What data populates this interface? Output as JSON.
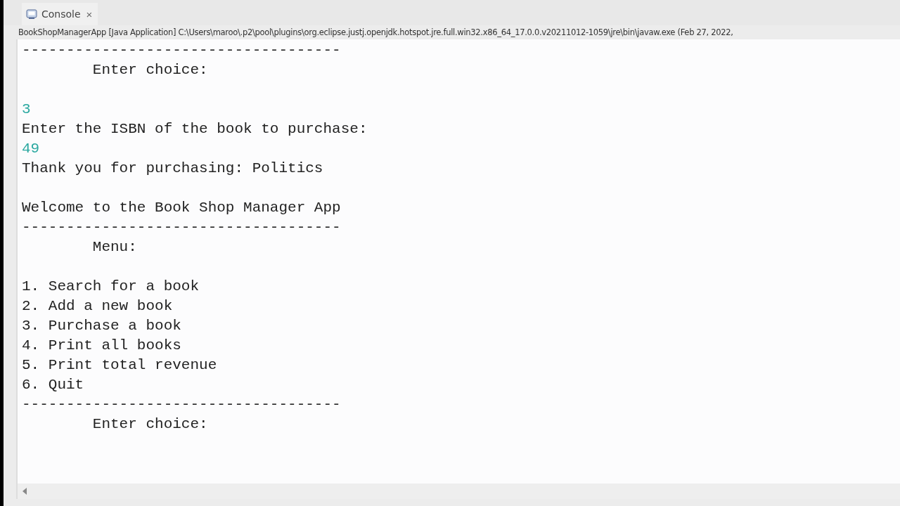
{
  "tab": {
    "label": "Console",
    "selected": true,
    "close_glyph": "×"
  },
  "launch_info": "BookShopManagerApp [Java Application] C:\\Users\\maroo\\.p2\\pool\\plugins\\org.eclipse.justj.openjdk.hotspot.jre.full.win32.x86_64_17.0.0.v20211012-1059\\jre\\bin\\javaw.exe  (Feb 27, 2022,",
  "console_lines": [
    {
      "kind": "output",
      "text": "------------------------------------"
    },
    {
      "kind": "output",
      "text": "        Enter choice:"
    },
    {
      "kind": "blank"
    },
    {
      "kind": "input",
      "text": "3"
    },
    {
      "kind": "output",
      "text": "Enter the ISBN of the book to purchase:"
    },
    {
      "kind": "input",
      "text": "49"
    },
    {
      "kind": "output",
      "text": "Thank you for purchasing: Politics"
    },
    {
      "kind": "blank"
    },
    {
      "kind": "output",
      "text": "Welcome to the Book Shop Manager App"
    },
    {
      "kind": "output",
      "text": "------------------------------------"
    },
    {
      "kind": "output",
      "text": "        Menu:"
    },
    {
      "kind": "blank"
    },
    {
      "kind": "output",
      "text": "1. Search for a book"
    },
    {
      "kind": "output",
      "text": "2. Add a new book"
    },
    {
      "kind": "output",
      "text": "3. Purchase a book"
    },
    {
      "kind": "output",
      "text": "4. Print all books"
    },
    {
      "kind": "output",
      "text": "5. Print total revenue"
    },
    {
      "kind": "output",
      "text": "6. Quit"
    },
    {
      "kind": "output",
      "text": "------------------------------------"
    },
    {
      "kind": "output",
      "text": "        Enter choice:"
    }
  ]
}
